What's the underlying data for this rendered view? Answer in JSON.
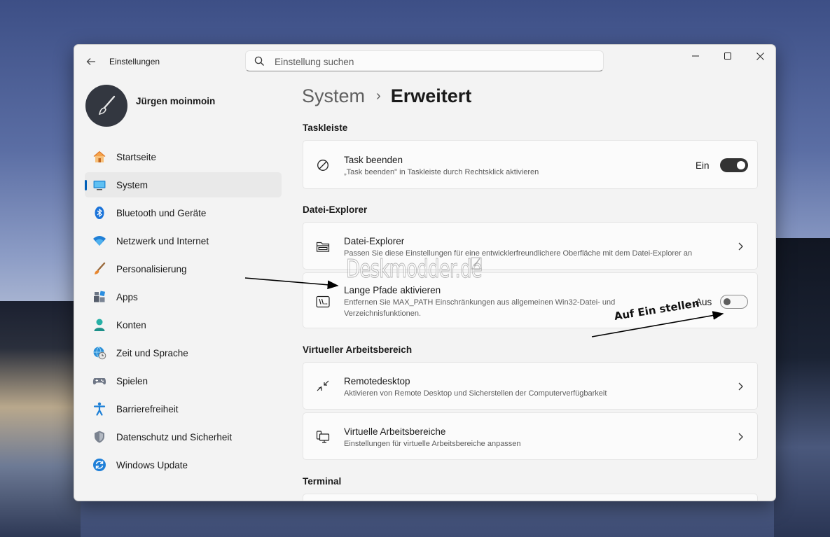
{
  "window": {
    "title": "Einstellungen"
  },
  "search": {
    "placeholder": "Einstellung suchen"
  },
  "profile": {
    "name": "Jürgen moinmoin"
  },
  "sidebar": {
    "items": [
      {
        "label": "Startseite",
        "icon": "home-icon",
        "active": false
      },
      {
        "label": "System",
        "icon": "system-icon",
        "active": true
      },
      {
        "label": "Bluetooth und Geräte",
        "icon": "bluetooth-icon",
        "active": false
      },
      {
        "label": "Netzwerk und Internet",
        "icon": "wifi-icon",
        "active": false
      },
      {
        "label": "Personalisierung",
        "icon": "brush-icon",
        "active": false
      },
      {
        "label": "Apps",
        "icon": "apps-icon",
        "active": false
      },
      {
        "label": "Konten",
        "icon": "account-icon",
        "active": false
      },
      {
        "label": "Zeit und Sprache",
        "icon": "globe-clock-icon",
        "active": false
      },
      {
        "label": "Spielen",
        "icon": "gamepad-icon",
        "active": false
      },
      {
        "label": "Barrierefreiheit",
        "icon": "accessibility-icon",
        "active": false
      },
      {
        "label": "Datenschutz und Sicherheit",
        "icon": "shield-icon",
        "active": false
      },
      {
        "label": "Windows Update",
        "icon": "update-icon",
        "active": false
      }
    ]
  },
  "breadcrumb": {
    "parent": "System",
    "separator": "›",
    "current": "Erweitert"
  },
  "sections": {
    "taskleiste": {
      "title": "Taskleiste",
      "task_beenden": {
        "title": "Task beenden",
        "desc": "„Task beenden\" in Taskleiste durch Rechtsklick aktivieren",
        "state_label": "Ein",
        "on": true
      }
    },
    "datei_explorer": {
      "title": "Datei-Explorer",
      "explorer": {
        "title": "Datei-Explorer",
        "desc": "Passen Sie diese Einstellungen für eine entwicklerfreundlichere Oberfläche mit dem Datei-Explorer an"
      },
      "lange_pfade": {
        "title": "Lange Pfade aktivieren",
        "desc": "Entfernen Sie MAX_PATH Einschränkungen aus allgemeinen Win32-Datei- und Verzeichnisfunktionen.",
        "state_label": "Aus",
        "on": false
      }
    },
    "virtueller": {
      "title": "Virtueller Arbeitsbereich",
      "remote": {
        "title": "Remotedesktop",
        "desc": "Aktivieren von Remote Desktop und Sicherstellen der Computerverfügbarkeit"
      },
      "virtuelle": {
        "title": "Virtuelle Arbeitsbereiche",
        "desc": "Einstellungen für virtuelle Arbeitsbereiche anpassen"
      }
    },
    "terminal": {
      "title": "Terminal"
    }
  },
  "annotations": {
    "watermark": "Deskmodder.de",
    "hint": "Auf Ein stellen"
  },
  "colors": {
    "accent": "#005fb8",
    "toggle_on": "#333333"
  }
}
